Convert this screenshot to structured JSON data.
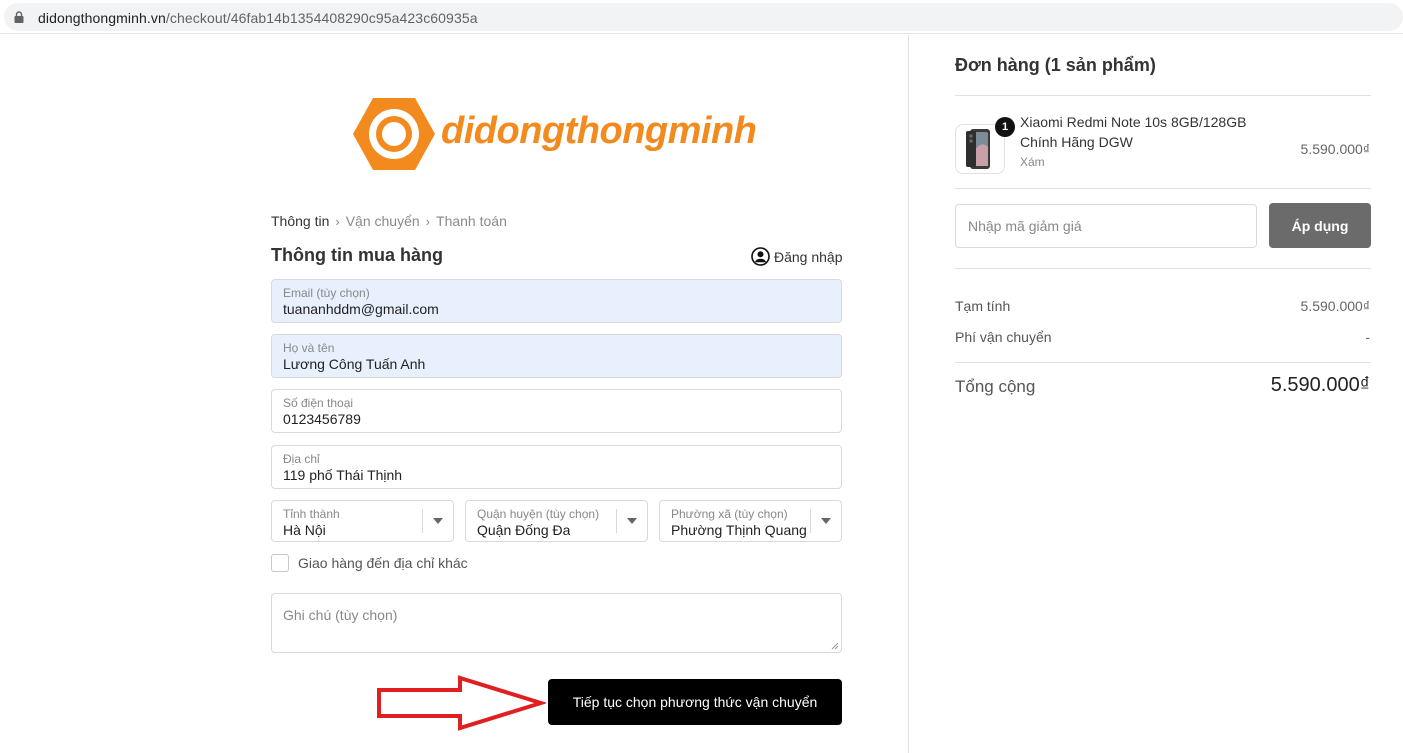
{
  "browser": {
    "url_domain": "didongthongminh.vn",
    "url_path": "/checkout/46fab14b1354408290c95a423c60935a"
  },
  "logo": {
    "text": "didongthongminh"
  },
  "breadcrumb": {
    "step1": "Thông tin",
    "step2": "Vận chuyển",
    "step3": "Thanh toán",
    "separator": "›"
  },
  "form": {
    "title": "Thông tin mua hàng",
    "login_label": "Đăng nhập",
    "email": {
      "label": "Email (tùy chọn)",
      "value": "tuananhddm@gmail.com"
    },
    "fullname": {
      "label": "Họ và tên",
      "value": "Lương Công Tuấn Anh"
    },
    "phone": {
      "label": "Số điện thoại",
      "value": "0123456789"
    },
    "address": {
      "label": "Địa chỉ",
      "value": "119 phố Thái Thịnh"
    },
    "province": {
      "label": "Tỉnh thành",
      "value": "Hà Nội"
    },
    "district": {
      "label": "Quận huyện (tùy chọn)",
      "value": "Quận Đống Đa"
    },
    "ward": {
      "label": "Phường xã (tùy chọn)",
      "value": "Phường Thịnh Quang"
    },
    "ship_other": {
      "label": "Giao hàng đến địa chỉ khác",
      "checked": false
    },
    "note_placeholder": "Ghi chú (tùy chọn)",
    "continue_label": "Tiếp tục chọn phương thức vận chuyển"
  },
  "order": {
    "title": "Đơn hàng (1 sản phẩm)",
    "product": {
      "name": "Xiaomi Redmi Note 10s 8GB/128GB Chính Hãng DGW",
      "variant": "Xám",
      "price": "5.590.000₫",
      "quantity": "1"
    },
    "coupon_placeholder": "Nhập mã giảm giá",
    "apply_label": "Áp dụng",
    "subtotal_label": "Tạm tính",
    "subtotal_value": "5.590.000₫",
    "shipping_label": "Phí vận chuyển",
    "shipping_value": "-",
    "total_label": "Tổng cộng",
    "total_value": "5.590.000₫"
  },
  "colors": {
    "brand_orange": "#f28a1e",
    "filled_field": "#e8f0fe",
    "button_black": "#000000",
    "apply_gray": "#6b6b6b",
    "arrow_red": "#e02020"
  }
}
